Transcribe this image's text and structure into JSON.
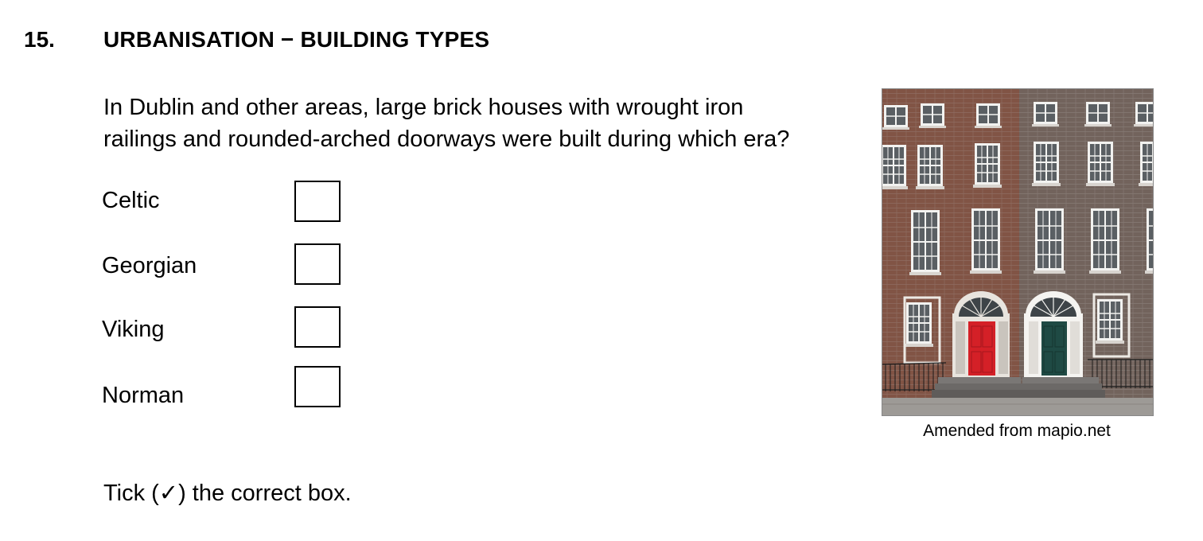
{
  "question": {
    "number": "15.",
    "title": "URBANISATION − BUILDING TYPES",
    "text_line1": "In Dublin and other areas, large brick houses with wrought iron",
    "text_line2": "railings and rounded-arched doorways were built during which era?"
  },
  "options": [
    {
      "label": "Celtic"
    },
    {
      "label": "Georgian"
    },
    {
      "label": "Viking"
    },
    {
      "label": "Norman"
    }
  ],
  "instruction": "Tick (✓) the correct box.",
  "image": {
    "caption": "Amended from mapio.net",
    "subject": "georgian-townhouses-photo"
  },
  "colors": {
    "brick_left": "#8a5a4a",
    "brick_right": "#7a6a62",
    "door_red": "#d42027",
    "door_green": "#1f4a44"
  }
}
